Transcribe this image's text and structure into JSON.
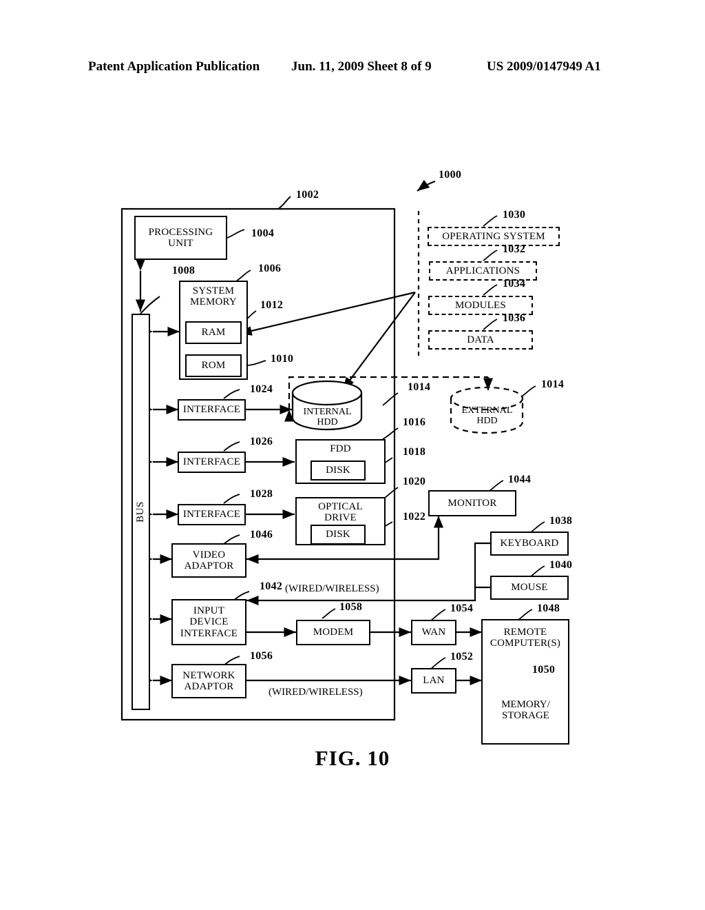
{
  "header": {
    "left": "Patent Application Publication",
    "middle": "Jun. 11, 2009  Sheet 8 of 9",
    "right": "US 2009/0147949 A1"
  },
  "figure": {
    "caption": "FIG. 10",
    "system_ref": "1000"
  },
  "computer": {
    "ref": "1002",
    "processing_unit": {
      "label": "PROCESSING\nUNIT",
      "ref": "1004"
    },
    "bus": {
      "label": "BUS",
      "ref": "1008"
    },
    "system_memory": {
      "label": "SYSTEM\nMEMORY",
      "ref": "1006"
    },
    "ram": {
      "label": "RAM",
      "ref": "1012"
    },
    "rom": {
      "label": "ROM",
      "ref": "1010"
    },
    "interface_hdd": {
      "label": "INTERFACE",
      "ref": "1024"
    },
    "interface_fdd": {
      "label": "INTERFACE",
      "ref": "1026"
    },
    "interface_optical": {
      "label": "INTERFACE",
      "ref": "1028"
    },
    "video_adaptor": {
      "label": "VIDEO\nADAPTOR",
      "ref": "1046"
    },
    "input_device_interface": {
      "label": "INPUT\nDEVICE\nINTERFACE",
      "ref": "1042"
    },
    "network_adaptor": {
      "label": "NETWORK\nADAPTOR",
      "ref": "1056"
    },
    "internal_hdd": {
      "label": "INTERNAL HDD",
      "ref": "1014"
    },
    "fdd": {
      "label": "FDD",
      "ref": "1016"
    },
    "fdd_disk": {
      "label": "DISK",
      "ref": "1018"
    },
    "optical_drive": {
      "label": "OPTICAL\nDRIVE",
      "ref": "1020"
    },
    "optical_disk": {
      "label": "DISK",
      "ref": "1022"
    },
    "modem": {
      "label": "MODEM",
      "ref": "1058"
    }
  },
  "software": {
    "operating_system": {
      "label": "OPERATING SYSTEM",
      "ref": "1030"
    },
    "applications": {
      "label": "APPLICATIONS",
      "ref": "1032"
    },
    "modules": {
      "label": "MODULES",
      "ref": "1034"
    },
    "data": {
      "label": "DATA",
      "ref": "1036"
    }
  },
  "peripherals": {
    "external_hdd": {
      "label": "EXTERNAL\nHDD",
      "ref": "1014"
    },
    "monitor": {
      "label": "MONITOR",
      "ref": "1044"
    },
    "keyboard": {
      "label": "KEYBOARD",
      "ref": "1038"
    },
    "mouse": {
      "label": "MOUSE",
      "ref": "1040"
    }
  },
  "network": {
    "wan": {
      "label": "WAN",
      "ref": "1054"
    },
    "lan": {
      "label": "LAN",
      "ref": "1052"
    },
    "remote_computers": {
      "label": "REMOTE\nCOMPUTER(S)",
      "ref": "1048"
    },
    "memory_storage": {
      "label": "MEMORY/\nSTORAGE",
      "ref": "1050"
    }
  },
  "annotations": {
    "wired_wireless_top": "(WIRED/WIRELESS)",
    "wired_wireless_bottom": "(WIRED/WIRELESS)"
  },
  "colors": {
    "ink": "#000000",
    "paper": "#ffffff"
  }
}
